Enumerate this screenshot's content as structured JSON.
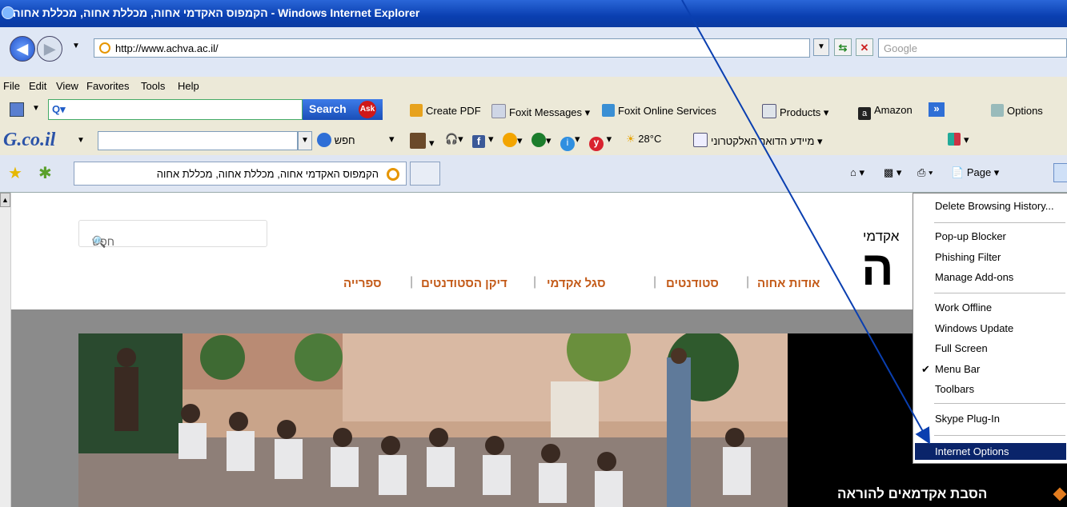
{
  "window": {
    "title": "הקמפוס האקדמי אחוה, מכללת אחוה, מכללת אחוה - Windows Internet Explorer"
  },
  "address_bar": {
    "url": "http://www.achva.ac.il/",
    "search_placeholder": "Google"
  },
  "menu_bar": {
    "items": [
      "File",
      "Edit",
      "View",
      "Favorites",
      "Tools",
      "Help"
    ]
  },
  "ask_toolbar": {
    "search_button": "Search",
    "ask_logo": "Ask",
    "create_pdf": "Create PDF",
    "foxit_messages": "Foxit Messages",
    "foxit_online": "Foxit Online Services",
    "products": "Products",
    "amazon": "Amazon",
    "options": "Options"
  },
  "walla_toolbar": {
    "brand": "G.co.il",
    "search_label": "חפש",
    "temperature": "28°C",
    "mail_info": "מיידע הדואר האלקטרוני"
  },
  "tab_bar": {
    "tab_title": "הקמפוס האקדמי אחוה, מכללת אחוה, מכללת אחוה",
    "page_label": "Page"
  },
  "site": {
    "search_label": "חפש",
    "nav": [
      "אודות אחוה",
      "סטודנטים",
      "סגל אקדמי",
      "דיקן הסטודנטים",
      "ספרייה"
    ],
    "logo_text": "אקדמי",
    "logo_big": "ה",
    "bottom_text": "הסבת אקדמאים להוראה"
  },
  "context_menu": {
    "items": [
      "Delete Browsing History...",
      "Pop-up Blocker",
      "Phishing Filter",
      "Manage Add-ons",
      "Work Offline",
      "Windows Update",
      "Full Screen",
      "Menu Bar",
      "Toolbars",
      "Skype Plug-In",
      "Internet Options"
    ],
    "checked_item": "Menu Bar",
    "highlighted_item": "Internet Options"
  }
}
